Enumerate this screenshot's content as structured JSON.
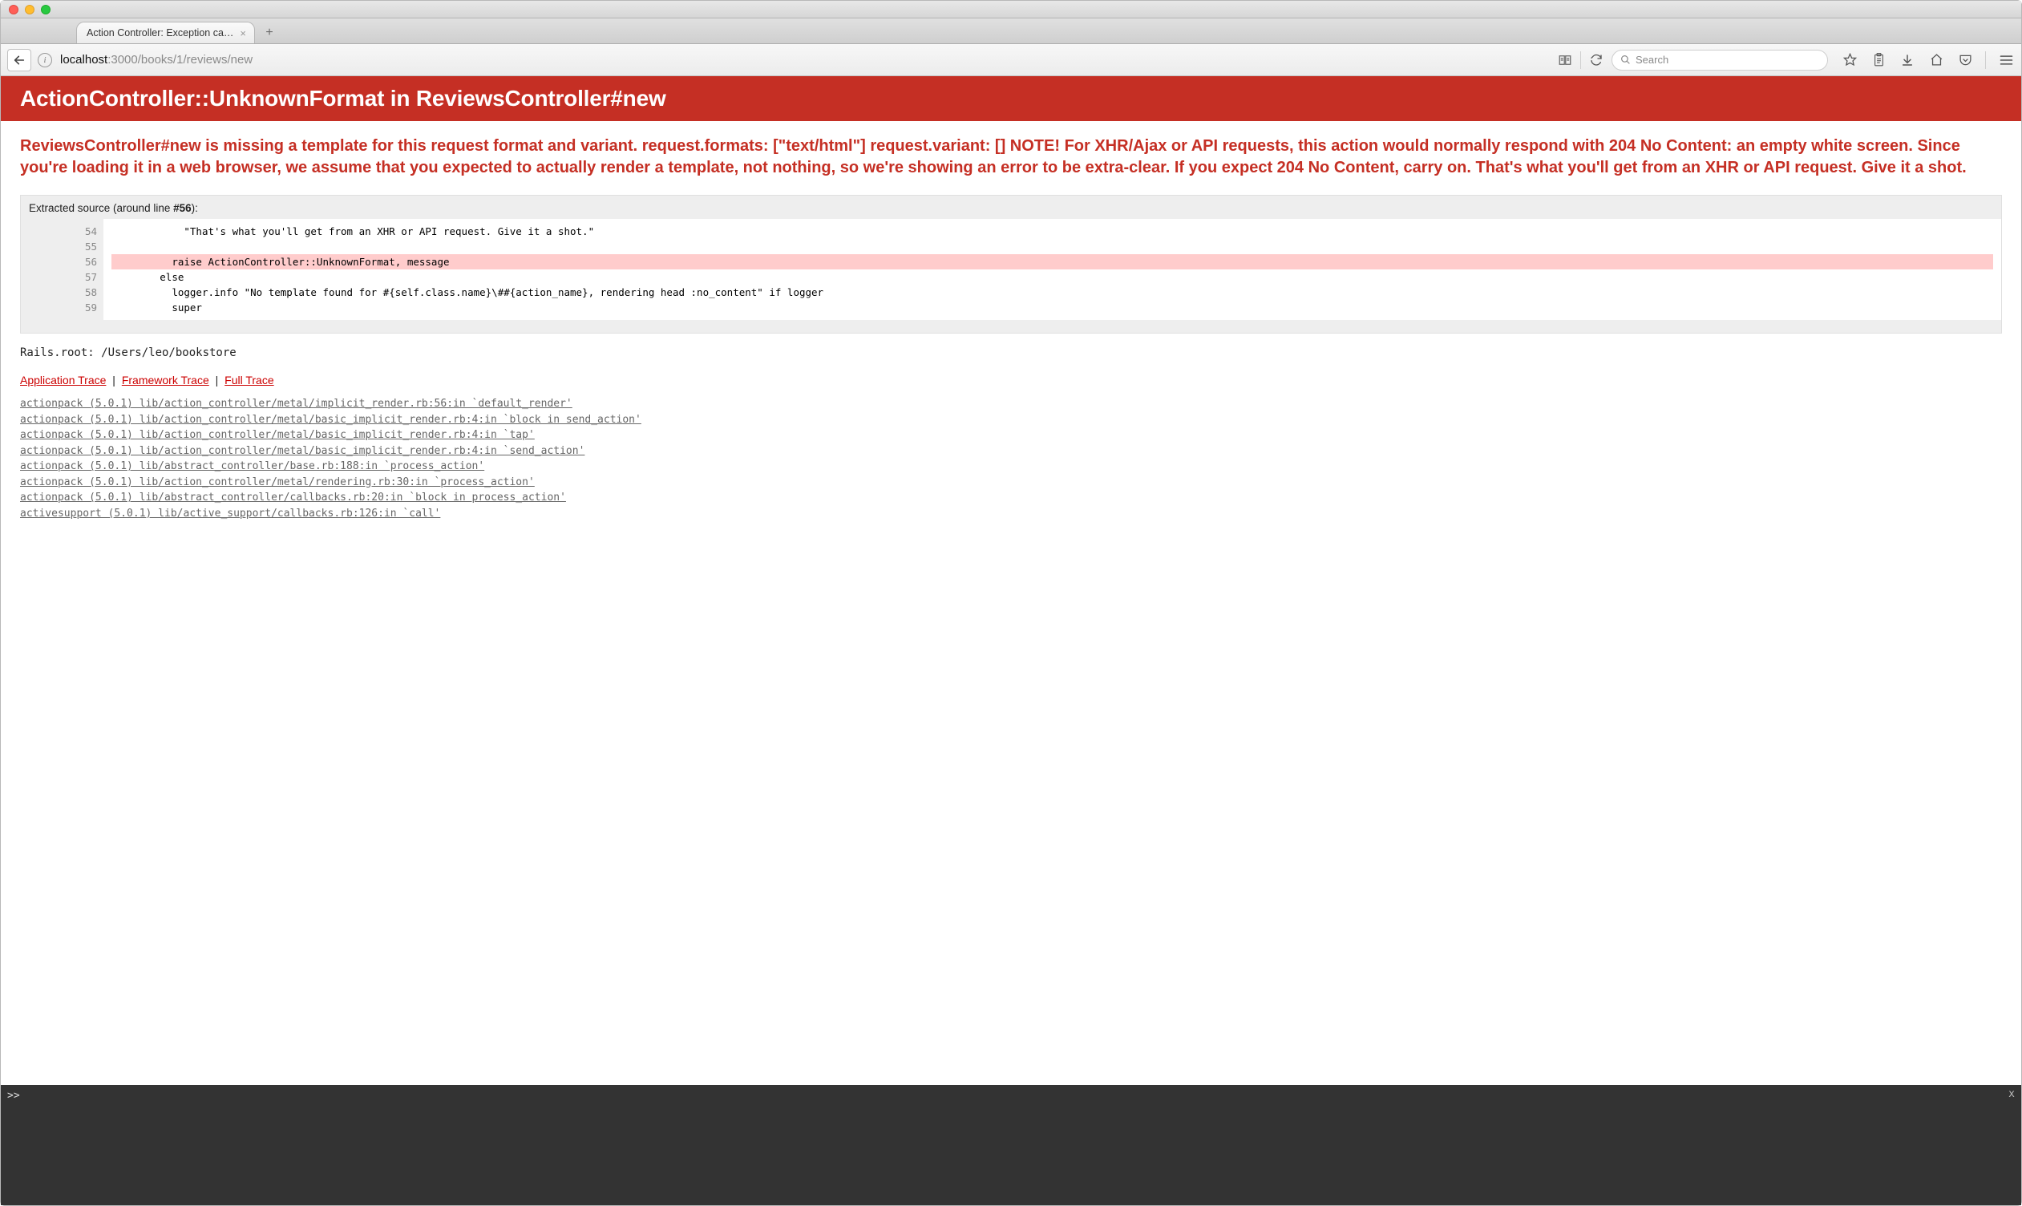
{
  "window": {
    "tab_title": "Action Controller: Exception ca…"
  },
  "toolbar": {
    "url_host": "localhost",
    "url_port_path": ":3000/books/1/reviews/new",
    "search_placeholder": "Search"
  },
  "error": {
    "heading": "ActionController::UnknownFormat in ReviewsController#new",
    "message": "ReviewsController#new is missing a template for this request format and variant. request.formats: [\"text/html\"] request.variant: [] NOTE! For XHR/Ajax or API requests, this action would normally respond with 204 No Content: an empty white screen. Since you're loading it in a web browser, we assume that you expected to actually render a template, not nothing, so we're showing an error to be extra-clear. If you expect 204 No Content, carry on. That's what you'll get from an XHR or API request. Give it a shot."
  },
  "source": {
    "header_prefix": "Extracted source (around line ",
    "header_line": "#56",
    "header_suffix": "):",
    "lines": [
      {
        "no": "54",
        "code": "            \"That's what you'll get from an XHR or API request. Give it a shot.\"",
        "hl": false
      },
      {
        "no": "55",
        "code": "",
        "hl": false
      },
      {
        "no": "56",
        "code": "          raise ActionController::UnknownFormat, message",
        "hl": true
      },
      {
        "no": "57",
        "code": "        else",
        "hl": false
      },
      {
        "no": "58",
        "code": "          logger.info \"No template found for #{self.class.name}\\##{action_name}, rendering head :no_content\" if logger",
        "hl": false
      },
      {
        "no": "59",
        "code": "          super",
        "hl": false
      }
    ]
  },
  "rails_root": "Rails.root: /Users/leo/bookstore",
  "trace_tabs": {
    "app": "Application Trace",
    "framework": "Framework Trace",
    "full": "Full Trace"
  },
  "trace": [
    "actionpack (5.0.1) lib/action_controller/metal/implicit_render.rb:56:in `default_render'",
    "actionpack (5.0.1) lib/action_controller/metal/basic_implicit_render.rb:4:in `block in send_action'",
    "actionpack (5.0.1) lib/action_controller/metal/basic_implicit_render.rb:4:in `tap'",
    "actionpack (5.0.1) lib/action_controller/metal/basic_implicit_render.rb:4:in `send_action'",
    "actionpack (5.0.1) lib/abstract_controller/base.rb:188:in `process_action'",
    "actionpack (5.0.1) lib/action_controller/metal/rendering.rb:30:in `process_action'",
    "actionpack (5.0.1) lib/abstract_controller/callbacks.rb:20:in `block in process_action'",
    "activesupport (5.0.1) lib/active_support/callbacks.rb:126:in `call'"
  ],
  "console": {
    "prompt": ">>",
    "close": "x"
  }
}
